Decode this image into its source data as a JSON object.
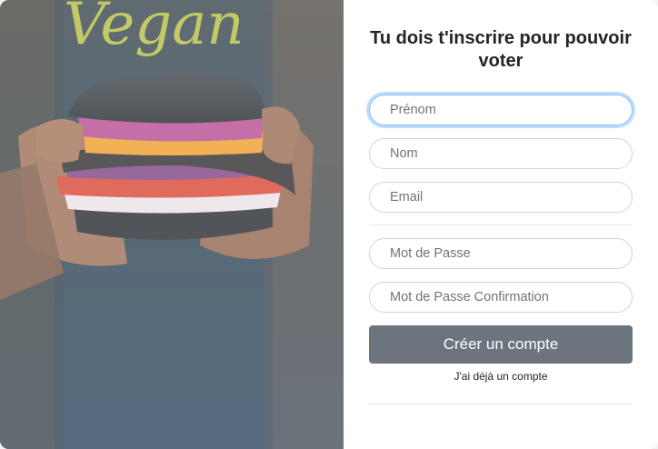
{
  "signup": {
    "title": "Tu dois t'inscrire pour pouvoir voter",
    "fields": {
      "first_name": {
        "placeholder": "Prénom",
        "value": ""
      },
      "last_name": {
        "placeholder": "Nom",
        "value": ""
      },
      "email": {
        "placeholder": "Email",
        "value": ""
      },
      "password": {
        "placeholder": "Mot de Passe",
        "value": ""
      },
      "password_confirm": {
        "placeholder": "Mot de Passe Confirmation",
        "value": ""
      }
    },
    "submit_label": "Créer un compte",
    "login_link_label": "J'ai déjà un compte"
  },
  "photo": {
    "shirt_text": "Vegan",
    "subject": "vegan-burger"
  },
  "colors": {
    "primary_button": "#6c757d",
    "focus_ring": "#80bdff",
    "field_border": "#ced4da"
  }
}
